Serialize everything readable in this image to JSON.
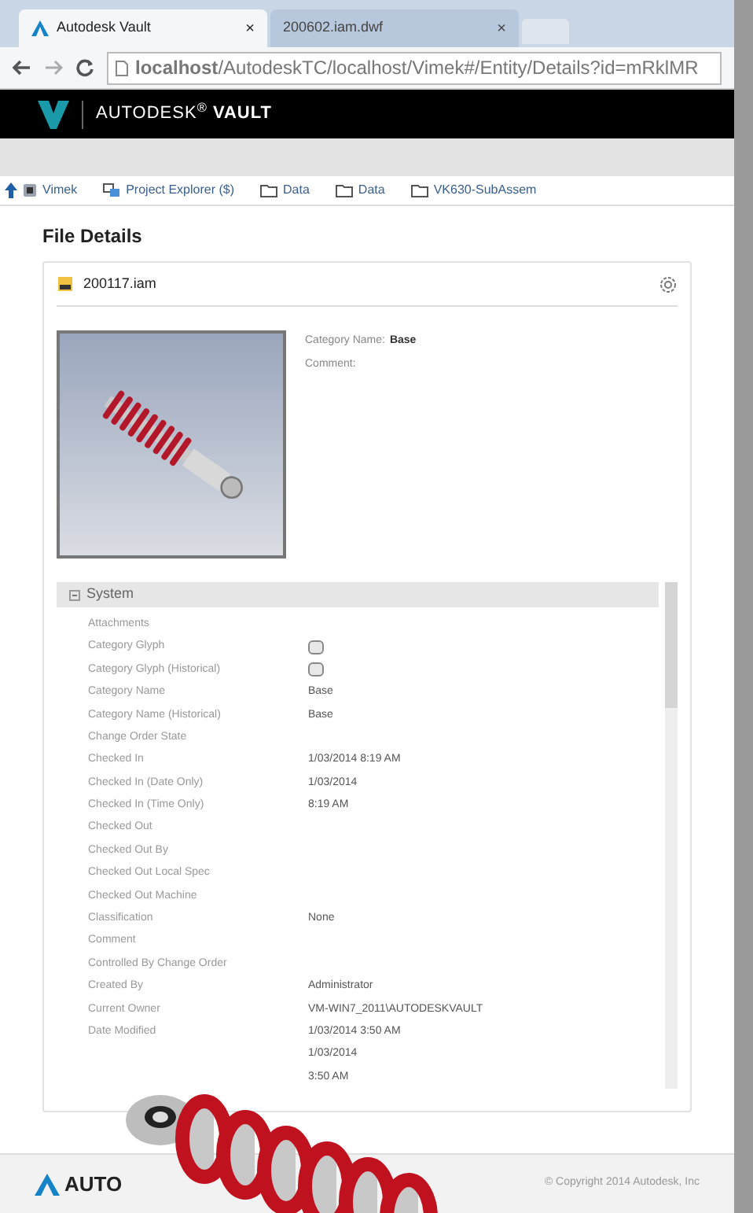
{
  "browser": {
    "tabs": [
      {
        "title": "Autodesk Vault",
        "close": "×",
        "selected": true
      },
      {
        "title": "200602.iam.dwf",
        "close": "×",
        "selected": false
      }
    ],
    "url": "**localhost**/AutodeskTC/localhost/Vimek#/Entity/Details?id=mRklMR"
  },
  "header": {
    "brand": "AUTODESK$^{®}$ **VAULT**"
  },
  "breadcrumbs": [
    {
      "label": "Vimek",
      "kind": "vault"
    },
    {
      "label": "Project Explorer ($)",
      "kind": "project"
    },
    {
      "label": "Data",
      "kind": "folder"
    },
    {
      "label": "Data",
      "kind": "folder"
    },
    {
      "label": "VK630-SubAssem",
      "kind": "folder"
    }
  ],
  "page_title": "File Details",
  "file": {
    "name": "200117.iam",
    "properties": [
      {
        "label": "Category Name:",
        "value": "Base"
      },
      {
        "label": "Comment:"
      }
    ]
  },
  "system": {
    "title": "System",
    "expanded": true,
    "rows": [
      {
        "label": "Attachments",
        "kind": "text"
      },
      {
        "label": "Category Glyph",
        "kind": "checkbox",
        "checked": false
      },
      {
        "label": "Category Glyph (Historical)",
        "kind": "checkbox",
        "checked": false
      },
      {
        "label": "Category Name",
        "kind": "text",
        "value": "Base"
      },
      {
        "label": "Category Name (Historical)",
        "kind": "text",
        "value": "Base"
      },
      {
        "label": "Change Order State",
        "kind": "text"
      },
      {
        "label": "Checked In",
        "kind": "text",
        "value": "1/03/2014 8:19 AM"
      },
      {
        "label": "Checked In (Date Only)",
        "kind": "text",
        "value": "1/03/2014"
      },
      {
        "label": "Checked In (Time Only)",
        "kind": "text",
        "value": "8:19 AM"
      },
      {
        "label": "Checked Out",
        "kind": "text"
      },
      {
        "label": "Checked Out By",
        "kind": "text"
      },
      {
        "label": "Checked Out Local Spec",
        "kind": "text"
      },
      {
        "label": "Checked Out Machine",
        "kind": "text"
      },
      {
        "label": "Classification",
        "kind": "text",
        "value": "None"
      },
      {
        "label": "Comment",
        "kind": "text"
      },
      {
        "label": "Controlled By Change Order",
        "kind": "text"
      },
      {
        "label": "Created By",
        "kind": "text",
        "value": "Administrator"
      },
      {
        "label": "Current Owner",
        "kind": "text",
        "value": "VM-WIN7_2011\\AUTODESKVAULT"
      },
      {
        "label": "Date Modified",
        "kind": "text",
        "value": "1/03/2014 3:50 AM"
      },
      {
        "kind": "text",
        "value": "1/03/2014"
      },
      {
        "kind": "text",
        "value": "3:50 AM"
      }
    ]
  },
  "footer": {
    "logo_text": "AUTO",
    "copyright": "© Copyright 2014 Autodesk, Inc"
  }
}
